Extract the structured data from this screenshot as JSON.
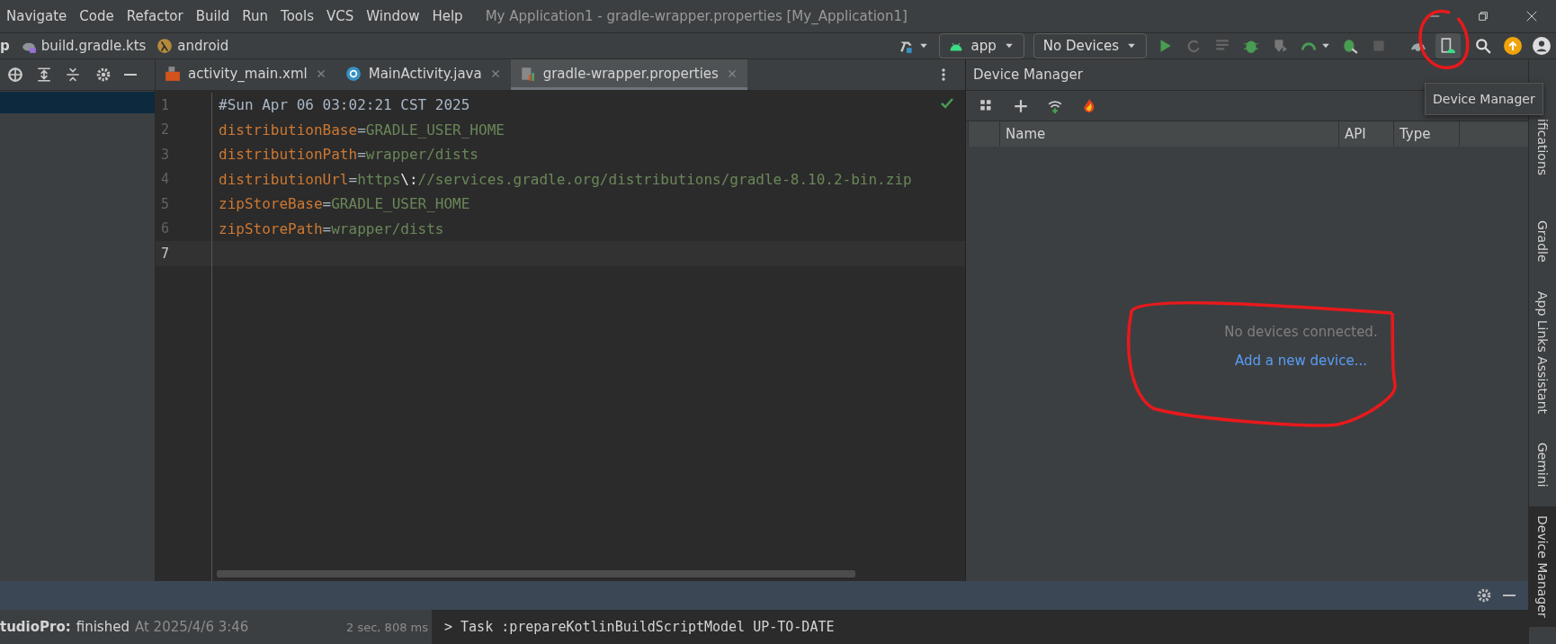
{
  "menu": [
    "Navigate",
    "Code",
    "Refactor",
    "Build",
    "Run",
    "Tools",
    "VCS",
    "Window",
    "Help"
  ],
  "window": {
    "title": "My Application1 - gradle-wrapper.properties [My_Application1]"
  },
  "breadcrumbs": [
    {
      "label": "p",
      "kind": "module"
    },
    {
      "label": "build.gradle.kts",
      "kind": "gradle"
    },
    {
      "label": "android",
      "kind": "lambda"
    }
  ],
  "toolbar": {
    "run_config": "app",
    "device": "No Devices",
    "device_manager_selected": true
  },
  "tabs": [
    {
      "label": "activity_main.xml",
      "kind": "xml",
      "selected": false
    },
    {
      "label": "MainActivity.java",
      "kind": "java",
      "selected": false
    },
    {
      "label": "gradle-wrapper.properties",
      "kind": "properties",
      "selected": true
    }
  ],
  "editor": {
    "lines": [
      {
        "number": "1",
        "current": false,
        "tokens": [
          {
            "kind": "comment",
            "text": "#Sun Apr 06 03:02:21 CST 2025"
          }
        ]
      },
      {
        "number": "2",
        "current": false,
        "tokens": [
          {
            "kind": "key",
            "text": "distributionBase"
          },
          {
            "kind": "sep",
            "text": "="
          },
          {
            "kind": "value",
            "text": "GRADLE_USER_HOME"
          }
        ]
      },
      {
        "number": "3",
        "current": false,
        "tokens": [
          {
            "kind": "key",
            "text": "distributionPath"
          },
          {
            "kind": "sep",
            "text": "="
          },
          {
            "kind": "value",
            "text": "wrapper/dists"
          }
        ]
      },
      {
        "number": "4",
        "current": false,
        "tokens": [
          {
            "kind": "key",
            "text": "distributionUrl"
          },
          {
            "kind": "sep",
            "text": "="
          },
          {
            "kind": "value",
            "text": "https"
          },
          {
            "kind": "escape",
            "text": "\\:"
          },
          {
            "kind": "value",
            "text": "//services.gradle.org/distributions/gradle-8.10.2-bin.zip"
          }
        ]
      },
      {
        "number": "5",
        "current": false,
        "tokens": [
          {
            "kind": "key",
            "text": "zipStoreBase"
          },
          {
            "kind": "sep",
            "text": "="
          },
          {
            "kind": "value",
            "text": "GRADLE_USER_HOME"
          }
        ]
      },
      {
        "number": "6",
        "current": false,
        "tokens": [
          {
            "kind": "key",
            "text": "zipStorePath"
          },
          {
            "kind": "sep",
            "text": "="
          },
          {
            "kind": "value",
            "text": "wrapper/dists"
          }
        ]
      },
      {
        "number": "7",
        "current": true
      }
    ]
  },
  "device_manager": {
    "title": "Device Manager",
    "columns": [
      "Name",
      "API",
      "Type"
    ],
    "empty_message": "No devices connected.",
    "add_link": "Add a new device..."
  },
  "tooltip": "Device Manager",
  "right_strip": [
    {
      "label": "ifications",
      "selected": false
    },
    {
      "label": "Gradle",
      "selected": false
    },
    {
      "label": "App Links Assistant",
      "selected": false
    },
    {
      "label": "Gemini",
      "selected": false
    },
    {
      "label": "Device Manager",
      "selected": true
    }
  ],
  "build": {
    "target": "tudioPro:",
    "status": "finished",
    "time": "At 2025/4/6 3:46",
    "duration": "2 sec, 808 ms",
    "output": "> Task :prepareKotlinBuildScriptModel UP-TO-DATE"
  }
}
